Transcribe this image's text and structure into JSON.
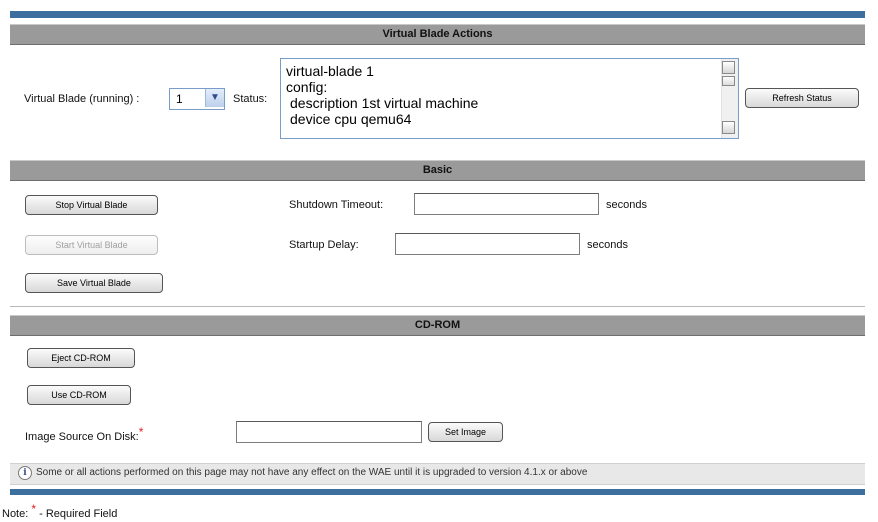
{
  "sections": {
    "actions_title": "Virtual Blade Actions",
    "basic_title": "Basic",
    "cdrom_title": "CD-ROM"
  },
  "actions": {
    "vb_label": "Virtual Blade (running) :",
    "vb_selected": "1",
    "status_label": "Status:",
    "status_lines": [
      "virtual-blade 1",
      "config:",
      " description 1st virtual machine",
      " device cpu qemu64"
    ],
    "refresh_button": "Refresh Status"
  },
  "basic": {
    "stop_button": "Stop Virtual Blade",
    "start_button": "Start Virtual Blade",
    "save_button": "Save Virtual Blade",
    "shutdown_label": "Shutdown Timeout:",
    "shutdown_value": "",
    "startup_label": "Startup Delay:",
    "startup_value": "",
    "seconds_unit": "seconds"
  },
  "cdrom": {
    "eject_button": "Eject CD-ROM",
    "use_button": "Use CD-ROM",
    "image_label": "Image Source On Disk:",
    "required_mark": "*",
    "image_value": "",
    "set_image_button": "Set Image"
  },
  "info": {
    "icon": "info-icon",
    "message": "Some or all actions performed on this page may not have any effect on the WAE until it is upgraded to version 4.1.x or above"
  },
  "footer": {
    "note_prefix": "Note:",
    "required_mark": "*",
    "note_suffix": "- Required Field"
  },
  "colors": {
    "header_gray": "#9a9a9a",
    "strip_blue": "#3c6e9e",
    "required_red": "#e02020"
  }
}
